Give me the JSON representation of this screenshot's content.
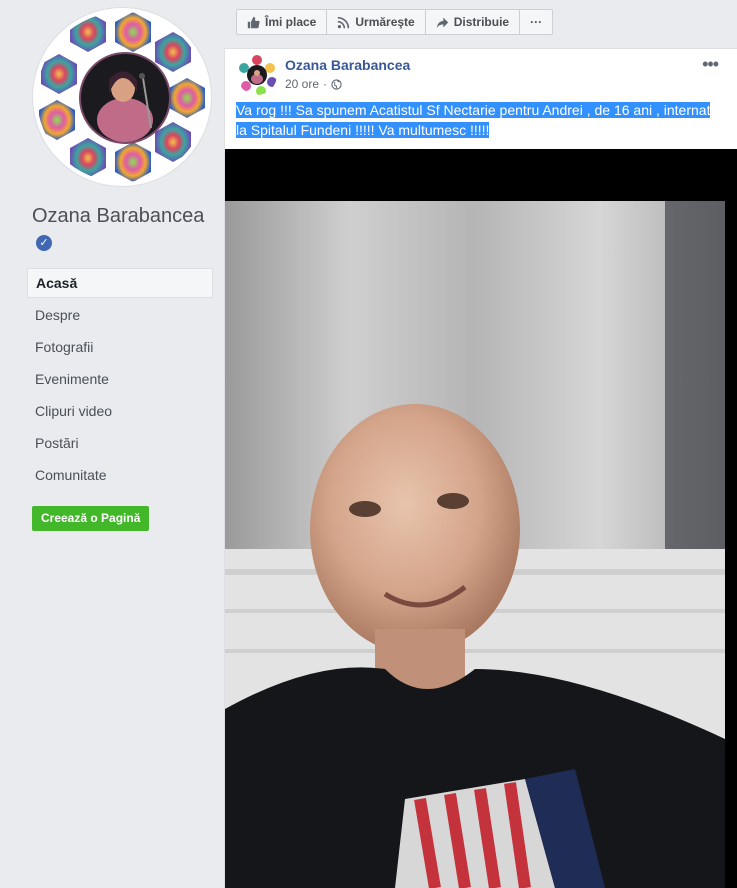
{
  "page": {
    "name": "Ozana Barabancea",
    "verified": true
  },
  "sidebar": {
    "nav": [
      {
        "label": "Acasă",
        "active": true
      },
      {
        "label": "Despre"
      },
      {
        "label": "Fotografii"
      },
      {
        "label": "Evenimente"
      },
      {
        "label": "Clipuri video"
      },
      {
        "label": "Postări"
      },
      {
        "label": "Comunitate"
      }
    ],
    "create_page_label": "Creează o Pagină"
  },
  "action_bar": {
    "like_label": "Îmi place",
    "follow_label": "Urmăreşte",
    "share_label": "Distribuie",
    "more_label": "···"
  },
  "post": {
    "author": "Ozana Barabancea",
    "time": "20 ore",
    "separator": "·",
    "text": "Va rog !!! Sa spunem Acatistul Sf Nectarie pentru Andrei , de 16 ani , internat la Spitalul Fundeni !!!!! Va multumesc !!!!!",
    "options_label": "•••"
  },
  "colors": {
    "brand": "#4267b2",
    "link": "#385898",
    "selection": "#3390ff",
    "create_button": "#42b72a"
  }
}
